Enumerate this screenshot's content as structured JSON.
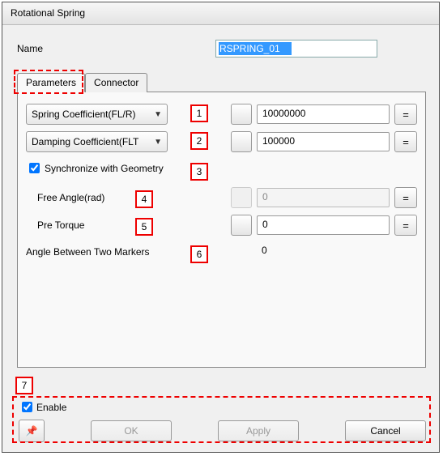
{
  "window": {
    "title": "Rotational Spring"
  },
  "name_row": {
    "label": "Name",
    "value": "RSPRING_01"
  },
  "tabs": {
    "parameters": "Parameters",
    "connector": "Connector"
  },
  "rows": {
    "spring": {
      "label": "Spring Coefficient(FL/R)",
      "value": "10000000"
    },
    "damping": {
      "label": "Damping Coefficient(FLT",
      "value": "100000"
    },
    "sync": {
      "label": "Synchronize with Geometry",
      "checked": true
    },
    "free_angle": {
      "label": "Free Angle(rad)",
      "value": "0"
    },
    "pre_torque": {
      "label": "Pre Torque",
      "value": "0"
    },
    "angle_between": {
      "label": "Angle Between Two Markers",
      "value": "0"
    }
  },
  "footer": {
    "enable": {
      "label": "Enable",
      "checked": true
    },
    "ok": "OK",
    "apply": "Apply",
    "cancel": "Cancel"
  },
  "equals": "=",
  "callouts": {
    "c1": "1",
    "c2": "2",
    "c3": "3",
    "c4": "4",
    "c5": "5",
    "c6": "6",
    "c7": "7"
  }
}
